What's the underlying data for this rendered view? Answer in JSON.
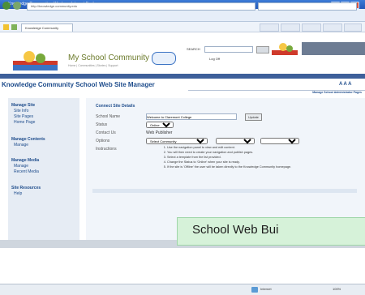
{
  "window": {
    "title": "Knowledge Community - Windows Internet Explorer"
  },
  "browser": {
    "address": "http://knowledge.community.edu",
    "tab_label": "Knowledge Community"
  },
  "site": {
    "name": "My School Community",
    "nav_links": "Home | Communities | Stories | Support",
    "search_label": "SEARCH",
    "login_label": "Log Off"
  },
  "page": {
    "title": "Knowledge Community School Web Site Manager",
    "right_header": "Manage School Administrator Pages"
  },
  "sidebar": {
    "sections": [
      {
        "heading": "Manage Site",
        "items": [
          "Site Info",
          "Site Pages",
          "Home Page"
        ]
      },
      {
        "heading": "Manage Contents",
        "items": [
          "Manage"
        ]
      },
      {
        "heading": "Manage Media",
        "items": [
          "Manage",
          "Recent Media"
        ]
      },
      {
        "heading": "Site Resources",
        "items": [
          "Help"
        ]
      }
    ]
  },
  "form": {
    "header": "Connect Site Details",
    "rows": [
      {
        "label": "School Name",
        "value": "Welcome to Claremont College",
        "button": "Update"
      },
      {
        "label": "Status",
        "value": "Online"
      },
      {
        "label": "Contact Us",
        "value": "Web Publisher"
      },
      {
        "label": "Options",
        "value": "Select Community"
      }
    ],
    "instructions_label": "Instructions",
    "instructions": [
      "Use the navigation panel to view and edit content.",
      "You will then need to create your navigation and publish pages.",
      "Select a template from the list provided.",
      "Change the Status to 'Online' when your site is ready.",
      "If the site is 'Offline' the user will be taken directly to the Knowledge Community homepage."
    ]
  },
  "banner": {
    "text": "School Web Bui"
  },
  "status": {
    "zone": "Internet",
    "zoom": "100%"
  }
}
